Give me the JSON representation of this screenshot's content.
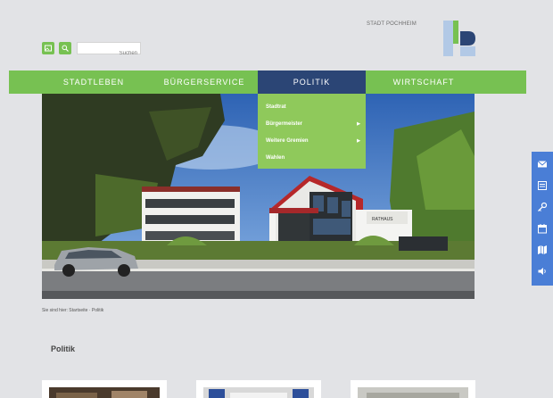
{
  "toolbar": {
    "buttons": [
      {
        "icon": "image-icon"
      },
      {
        "icon": "search-icon"
      }
    ],
    "search_placeholder": "Suchen"
  },
  "logo": {
    "text": "STADT POCHHEIM",
    "colors": {
      "light_blue": "#b2c9e6",
      "dark_blue": "#2b4575",
      "green": "#77c152"
    }
  },
  "nav": {
    "items": [
      {
        "label": "STADTLEBEN",
        "active": false
      },
      {
        "label": "BÜRGERSERVICE",
        "active": false
      },
      {
        "label": "POLITIK",
        "active": true
      },
      {
        "label": "WIRTSCHAFT",
        "active": false
      }
    ],
    "colors": {
      "bar": "#77c152",
      "active": "#2b4575"
    }
  },
  "dropdown": {
    "items": [
      {
        "label": "Stadtrat",
        "has_submenu": false
      },
      {
        "label": "Bürgermeister",
        "has_submenu": true
      },
      {
        "label": "Weitere Gremien",
        "has_submenu": true
      },
      {
        "label": "Wahlen",
        "has_submenu": false
      }
    ],
    "arrow": "▶"
  },
  "hero": {
    "building_sign": "RATHAUS"
  },
  "side_toolbar": {
    "icons": [
      "mail-icon",
      "newsletter-icon",
      "key-icon",
      "calendar-icon",
      "map-icon",
      "speaker-icon"
    ]
  },
  "breadcrumb": "Sie sind hier: Startseite · Politik",
  "section": {
    "title": "Politik"
  },
  "cards": [
    {
      "thumb": "card-thumbnail-interior"
    },
    {
      "thumb": "card-thumbnail-flags"
    },
    {
      "thumb": "card-thumbnail-hall"
    }
  ]
}
